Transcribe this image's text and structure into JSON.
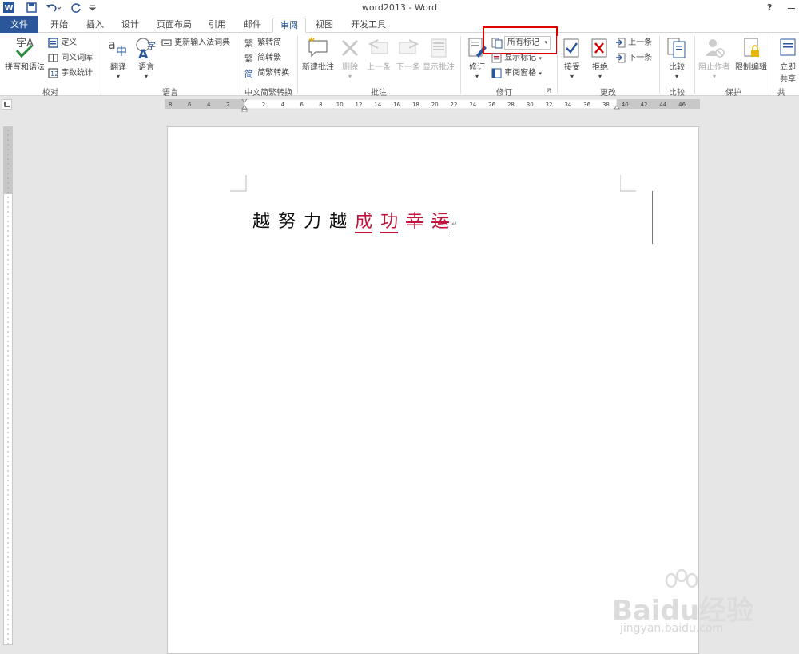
{
  "window": {
    "title": "word2013 - Word",
    "help": "?"
  },
  "tabs": [
    "文件",
    "开始",
    "插入",
    "设计",
    "页面布局",
    "引用",
    "邮件",
    "审阅",
    "视图",
    "开发工具"
  ],
  "active_tab": "审阅",
  "ribbon": {
    "proofing": {
      "group": "校对",
      "spell": "拼写和语法",
      "define": "定义",
      "thesaurus": "同义词库",
      "wordcount": "字数统计"
    },
    "ime": {
      "update": "更新输入法词典"
    },
    "language": {
      "group": "语言",
      "translate": "翻译",
      "language": "语言"
    },
    "chinese": {
      "group": "中文简繁转换",
      "to_simplified": "繁转简",
      "to_traditional": "简转繁",
      "convert": "简繁转换"
    },
    "comments": {
      "group": "批注",
      "new": "新建批注",
      "delete": "删除",
      "prev": "上一条",
      "next": "下一条",
      "show": "显示批注"
    },
    "tracking": {
      "group": "修订",
      "track": "修订",
      "markup_select": "所有标记",
      "show_markup": "显示标记",
      "pane": "审阅窗格"
    },
    "changes": {
      "group": "更改",
      "accept": "接受",
      "reject": "拒绝",
      "prev": "上一条",
      "next": "下一条"
    },
    "compare": {
      "group": "比较",
      "compare": "比较"
    },
    "protect": {
      "group": "保护",
      "block": "阻止作者",
      "restrict": "限制编辑"
    },
    "share": {
      "line1": "立即",
      "line2": "共享"
    }
  },
  "ruler": {
    "left_ticks": [
      "8",
      "6",
      "4",
      "2"
    ],
    "right_ticks": [
      "2",
      "4",
      "6",
      "8",
      "10",
      "12",
      "14",
      "16",
      "18",
      "20",
      "22",
      "24",
      "26",
      "28",
      "30",
      "32",
      "34",
      "36",
      "38",
      "40",
      "42",
      "44",
      "46"
    ]
  },
  "document": {
    "plain": [
      "越",
      "努",
      "力",
      "越"
    ],
    "inserted": [
      "成",
      "功"
    ],
    "deleted": [
      "幸",
      "运"
    ]
  },
  "colors": {
    "accent": "#2b579a",
    "revision": "#c0143c",
    "highlight_box": "#e00000"
  },
  "watermark": {
    "brand": "Baidu经验",
    "url": "jingyan.baidu.com"
  }
}
